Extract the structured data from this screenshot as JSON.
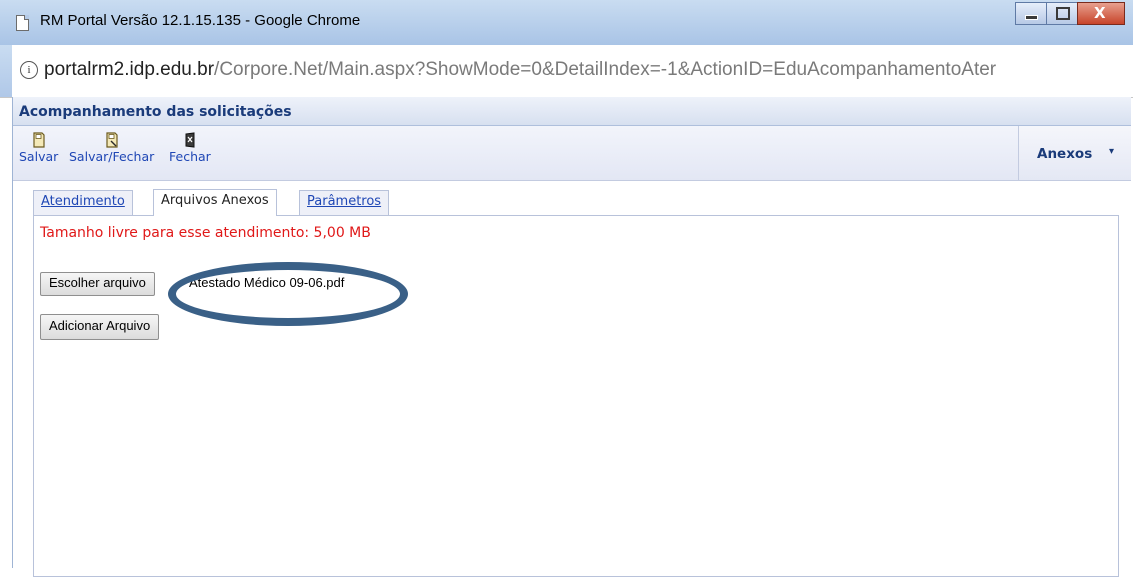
{
  "window": {
    "title": "RM Portal Versão 12.1.15.135 - Google Chrome",
    "close_glyph": "X",
    "icons": [
      "page-icon",
      "minimize-icon",
      "maximize-icon",
      "close-icon"
    ]
  },
  "address_bar": {
    "info_glyph": "i",
    "host": "portalrm2.idp.edu.br",
    "path": "/Corpore.Net/Main.aspx?ShowMode=0&DetailIndex=-1&ActionID=EduAcompanhamentoAter"
  },
  "app": {
    "title": "Acompanhamento das solicitações"
  },
  "toolbar": {
    "save_label": "Salvar",
    "save_close_label": "Salvar/Fechar",
    "close_label": "Fechar",
    "anexos_label": "Anexos",
    "anexos_caret": "▾"
  },
  "tabs": [
    {
      "label": "Atendimento",
      "active": false
    },
    {
      "label": "Arquivos Anexos",
      "active": true
    },
    {
      "label": "Parâmetros",
      "active": false
    }
  ],
  "attachments": {
    "free_space_text": "Tamanho livre para esse atendimento: 5,00 MB",
    "choose_file_label": "Escolher arquivo",
    "selected_file": "Atestado Médico 09-06.pdf",
    "add_file_label": "Adicionar Arquivo"
  },
  "colors": {
    "link_blue": "#1f47b5",
    "title_navy": "#1a3b7a",
    "warning_red": "#e01818",
    "annotation_ring": "#3a6087"
  }
}
